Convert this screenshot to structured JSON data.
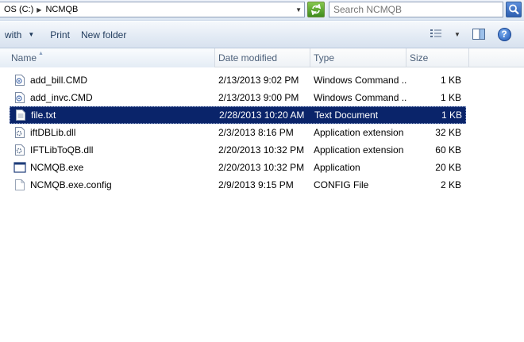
{
  "address": {
    "crumbs": [
      "OS (C:)",
      "NCMQB"
    ]
  },
  "search": {
    "placeholder": "Search NCMQB"
  },
  "toolbar": {
    "open_with_label": "with",
    "print_label": "Print",
    "new_folder_label": "New folder"
  },
  "columns": {
    "name": "Name",
    "date": "Date modified",
    "type": "Type",
    "size": "Size"
  },
  "files": [
    {
      "name": "add_bill.CMD",
      "date": "2/13/2013 9:02 PM",
      "type": "Windows Command ...",
      "size": "1 KB",
      "icon": "cmd-icon"
    },
    {
      "name": "add_invc.CMD",
      "date": "2/13/2013 9:00 PM",
      "type": "Windows Command ...",
      "size": "1 KB",
      "icon": "cmd-icon"
    },
    {
      "name": "file.txt",
      "date": "2/28/2013 10:20 AM",
      "type": "Text Document",
      "size": "1 KB",
      "icon": "text-file-icon",
      "selected": true
    },
    {
      "name": "iftDBLib.dll",
      "date": "2/3/2013 8:16 PM",
      "type": "Application extension",
      "size": "32 KB",
      "icon": "dll-icon"
    },
    {
      "name": "IFTLibToQB.dll",
      "date": "2/20/2013 10:32 PM",
      "type": "Application extension",
      "size": "60 KB",
      "icon": "dll-icon"
    },
    {
      "name": "NCMQB.exe",
      "date": "2/20/2013 10:32 PM",
      "type": "Application",
      "size": "20 KB",
      "icon": "exe-icon"
    },
    {
      "name": "NCMQB.exe.config",
      "date": "2/9/2013 9:15 PM",
      "type": "CONFIG File",
      "size": "2 KB",
      "icon": "config-file-icon"
    }
  ],
  "colors": {
    "selection": "#0a246a",
    "header_text": "#4c607a",
    "toolbar_text": "#1e395b"
  }
}
